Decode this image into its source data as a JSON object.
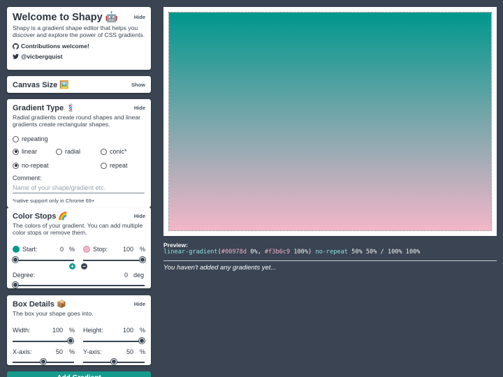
{
  "welcome": {
    "title": "Welcome to Shapy 🤖",
    "toggle": "Hide",
    "description": "Shapy is a gradient shape editor that helps you discover and explore the power of CSS gradients.",
    "link_contrib": "Contributions welcome!",
    "link_twitter": "@vicbergquist"
  },
  "canvas_size": {
    "title": "Canvas Size 🖼️",
    "toggle": "Show"
  },
  "gradient_type": {
    "title": "Gradient Type 💈",
    "toggle": "Hide",
    "description": "Radial gradients create round shapes and linear gradients create rectangular shapes.",
    "options": {
      "repeating": "repeating",
      "linear": "linear",
      "radial": "radial",
      "conic": "conic*",
      "no_repeat": "no-repeat",
      "repeat": "repeat"
    },
    "selected": [
      "linear",
      "no-repeat"
    ],
    "comment_label": "Comment:",
    "comment_placeholder": "Name of your shape/gradient etc.",
    "note": "*native support only in Chrome 69+"
  },
  "color_stops": {
    "title": "Color Stops 🌈",
    "toggle": "Hide",
    "description": "The colors of your gradient. You can add multiple color stops or remove them.",
    "start_label": "Start:",
    "start_value": "0",
    "start_color": "#00978d",
    "stop_label": "Stop:",
    "stop_value": "100",
    "stop_color": "#f3b6c9",
    "unit": "%",
    "degree_label": "Degree:",
    "degree_value": "0",
    "degree_unit": "deg"
  },
  "box_details": {
    "title": "Box Details 📦",
    "toggle": "Hide",
    "description": "The box your shape goes into.",
    "width_label": "Width:",
    "width_value": "100",
    "height_label": "Height:",
    "height_value": "100",
    "xaxis_label": "X-axis:",
    "xaxis_value": "50",
    "yaxis_label": "Y-axis:",
    "yaxis_value": "50",
    "unit": "%"
  },
  "add_button": "Add Gradient",
  "preview": {
    "label": "Preview:",
    "fn": "linear-gradient",
    "c1": "#00978d",
    "p1": "0%",
    "c2": "#f3b6c9",
    "p2": "100%",
    "repeat": "no-repeat",
    "rest": "50% 50% / 100% 100%"
  },
  "empty_message": "You haven't added any gradients yet...",
  "colors": {
    "accent": "#159a8c",
    "bg": "#3a4452"
  }
}
